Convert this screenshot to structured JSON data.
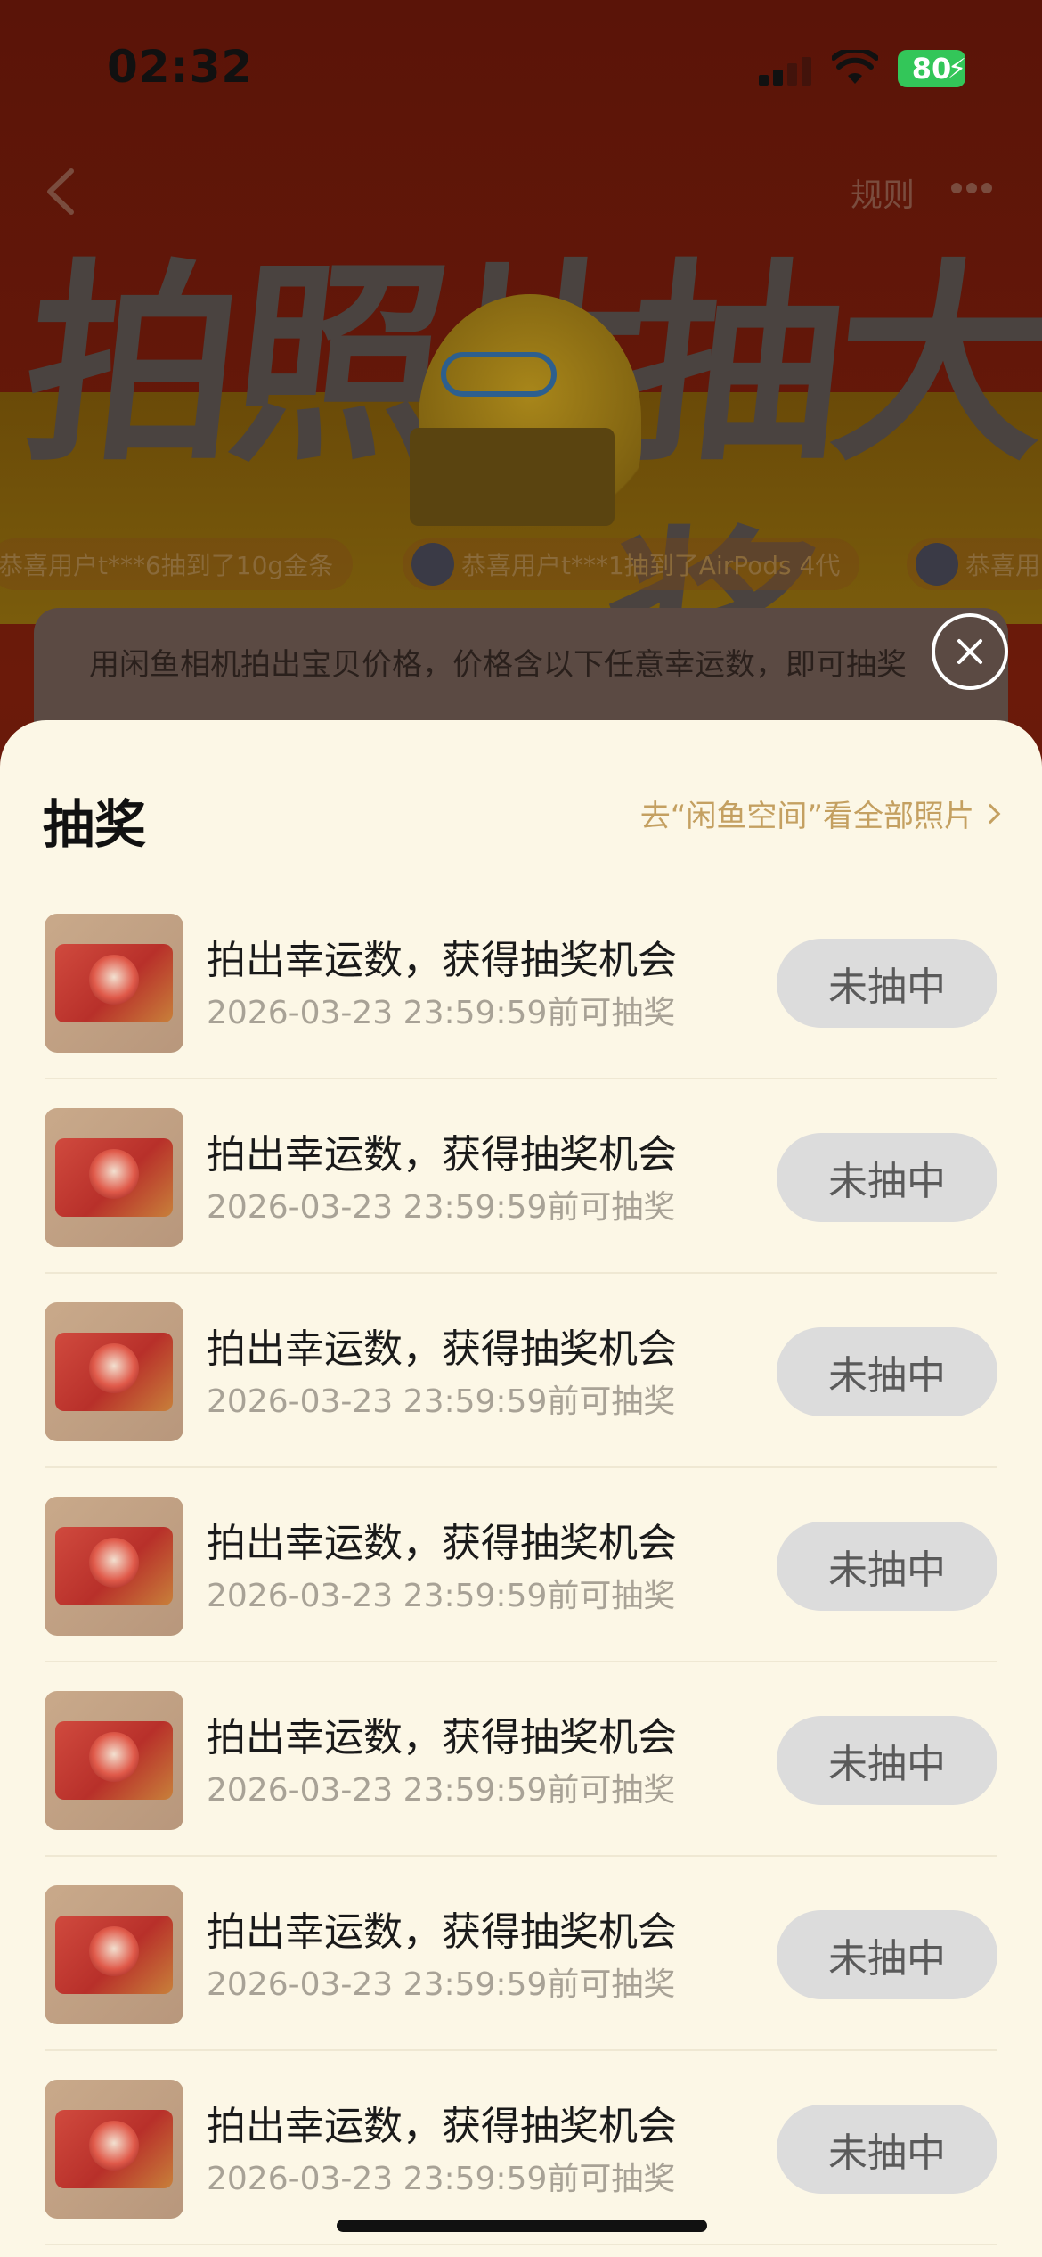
{
  "status_bar": {
    "time": "02:32",
    "battery": "80"
  },
  "header": {
    "rules_label": "规则"
  },
  "hero": {
    "left_text": "拍照片",
    "right_text": "抽大奖"
  },
  "ticker": [
    "恭喜用户t***6抽到了10g金条",
    "恭喜用户t***1抽到了AirPods 4代",
    "恭喜用"
  ],
  "rule_card": {
    "text": "用闲鱼相机拍出宝贝价格，价格含以下任意幸运数，即可抽奖"
  },
  "sheet": {
    "title": "抽奖",
    "link_label": "去“闲鱼空间”看全部照片",
    "items": [
      {
        "title": "拍出幸运数，获得抽奖机会",
        "deadline": "2026-03-23 23:59:59前可抽奖",
        "status": "未抽中"
      },
      {
        "title": "拍出幸运数，获得抽奖机会",
        "deadline": "2026-03-23 23:59:59前可抽奖",
        "status": "未抽中"
      },
      {
        "title": "拍出幸运数，获得抽奖机会",
        "deadline": "2026-03-23 23:59:59前可抽奖",
        "status": "未抽中"
      },
      {
        "title": "拍出幸运数，获得抽奖机会",
        "deadline": "2026-03-23 23:59:59前可抽奖",
        "status": "未抽中"
      },
      {
        "title": "拍出幸运数，获得抽奖机会",
        "deadline": "2026-03-23 23:59:59前可抽奖",
        "status": "未抽中"
      },
      {
        "title": "拍出幸运数，获得抽奖机会",
        "deadline": "2026-03-23 23:59:59前可抽奖",
        "status": "未抽中"
      },
      {
        "title": "拍出幸运数，获得抽奖机会",
        "deadline": "2026-03-23 23:59:59前可抽奖",
        "status": "未抽中"
      }
    ]
  },
  "colors": {
    "sheet_bg": "#fcf7e6",
    "link": "#c4a061",
    "button_bg": "#dcdcdc",
    "battery": "#33c659"
  }
}
